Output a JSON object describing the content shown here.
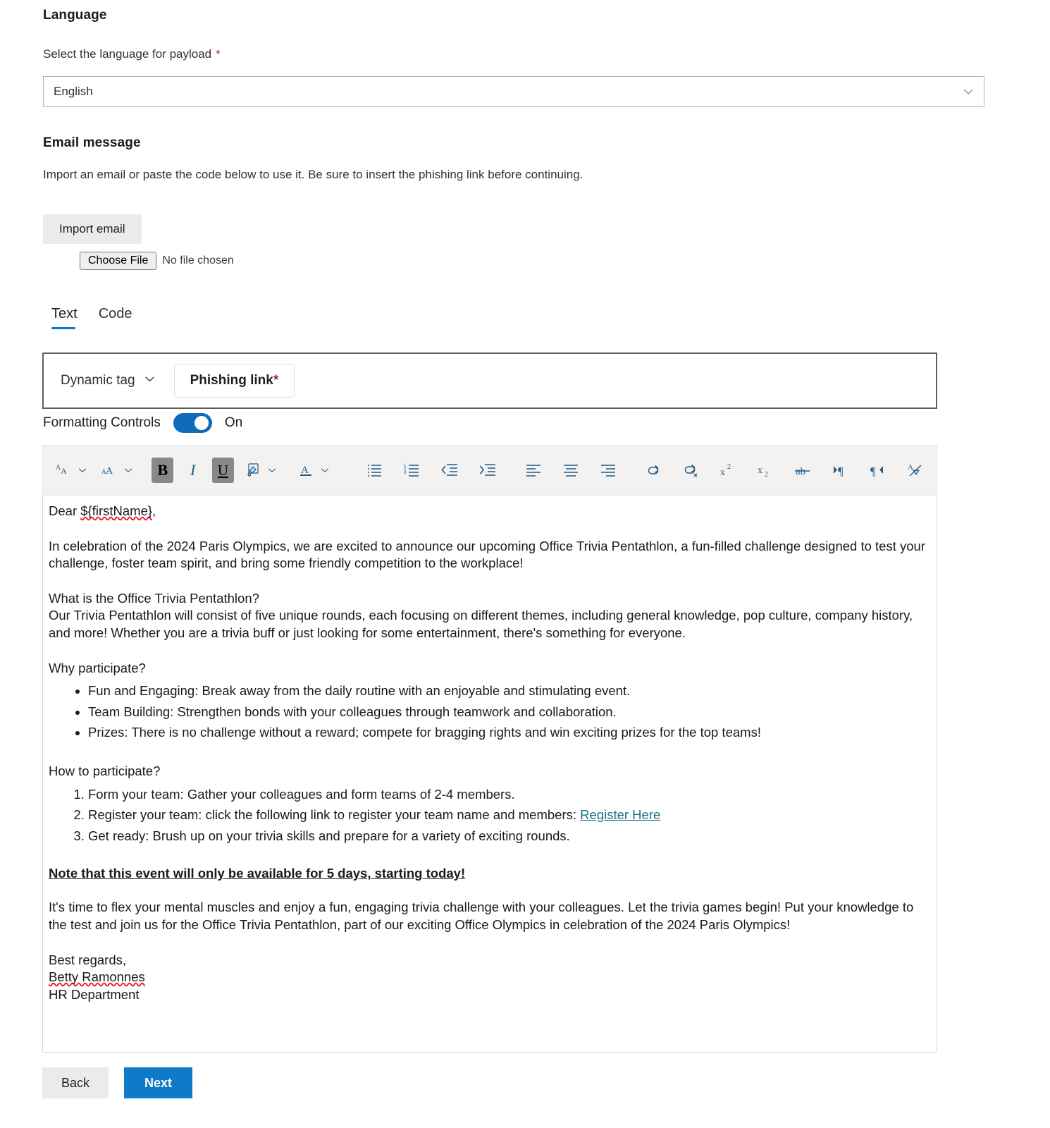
{
  "language_section": {
    "heading": "Language",
    "field_label": "Select the language for payload",
    "required_marker": "*",
    "selected_value": "English",
    "chevron_icon": "chevron-down-icon"
  },
  "email_section": {
    "heading": "Email message",
    "description": "Import an email or paste the code below to use it. Be sure to insert the phishing link before continuing.",
    "import_button": "Import email",
    "choose_file_button": "Choose File",
    "no_file_text": "No file chosen"
  },
  "tabs": [
    {
      "label": "Text",
      "active": true
    },
    {
      "label": "Code",
      "active": false
    }
  ],
  "tag_bar": {
    "dynamic_tag_label": "Dynamic tag",
    "dynamic_tag_chevron": "chevron-down-icon",
    "phishing_link_label": "Phishing link",
    "phishing_link_star": "*"
  },
  "formatting": {
    "label": "Formatting Controls",
    "toggle_state": "On",
    "toggle_on": true,
    "toggle_color": "#0f6cbd"
  },
  "toolbar": [
    {
      "name": "decrease-font-size-icon",
      "glyph": "Aᴀ",
      "type": "icon",
      "caret": true
    },
    {
      "name": "increase-font-size-icon",
      "glyph": "ᴀA",
      "type": "icon",
      "caret": true
    },
    {
      "name": "bold-icon",
      "glyph": "B",
      "type": "bold",
      "active": true
    },
    {
      "name": "italic-icon",
      "glyph": "I",
      "type": "ital"
    },
    {
      "name": "underline-icon",
      "glyph": "U",
      "type": "und",
      "active": true
    },
    {
      "name": "highlight-color-icon",
      "glyph": "svg-highlight",
      "type": "svg",
      "caret": true
    },
    {
      "name": "font-color-icon",
      "glyph": "svg-fontcolor",
      "type": "svg",
      "caret": true
    },
    {
      "name": "bulleted-list-icon",
      "glyph": "svg-bullets",
      "type": "svg"
    },
    {
      "name": "numbered-list-icon",
      "glyph": "svg-numbers",
      "type": "svg"
    },
    {
      "name": "decrease-indent-icon",
      "glyph": "svg-outdent",
      "type": "svg"
    },
    {
      "name": "increase-indent-icon",
      "glyph": "svg-indent",
      "type": "svg"
    },
    {
      "name": "align-left-icon",
      "glyph": "svg-alignleft",
      "type": "svg"
    },
    {
      "name": "align-center-icon",
      "glyph": "svg-aligncenter",
      "type": "svg"
    },
    {
      "name": "align-right-icon",
      "glyph": "svg-alignright",
      "type": "svg"
    },
    {
      "name": "insert-link-icon",
      "glyph": "svg-link",
      "type": "svg"
    },
    {
      "name": "remove-link-icon",
      "glyph": "svg-unlink",
      "type": "svg"
    },
    {
      "name": "superscript-icon",
      "glyph": "svg-sup",
      "type": "svg"
    },
    {
      "name": "subscript-icon",
      "glyph": "svg-sub",
      "type": "svg"
    },
    {
      "name": "strikethrough-icon",
      "glyph": "svg-strike",
      "type": "svg"
    },
    {
      "name": "ltr-direction-icon",
      "glyph": "svg-ltr",
      "type": "svg"
    },
    {
      "name": "rtl-direction-icon",
      "glyph": "svg-rtl",
      "type": "svg"
    },
    {
      "name": "clear-formatting-icon",
      "glyph": "svg-clear",
      "type": "svg"
    }
  ],
  "email_body": {
    "greeting": "Dear ${firstName},",
    "greeting_plain_prefix": "Dear ",
    "greeting_var": "${firstName}",
    "greeting_suffix": ",",
    "intro": "In celebration of the 2024 Paris Olympics, we are excited to announce our upcoming Office Trivia Pentathlon, a fun-filled challenge designed to test your challenge, foster team spirit, and bring some friendly competition to the workplace!",
    "what_heading": "What is the Office Trivia Pentathlon?",
    "what_body": "Our Trivia Pentathlon will consist of five unique rounds, each focusing on different themes, including general knowledge, pop culture, company history, and more! Whether you are a trivia buff or just looking for some entertainment, there's something for everyone.",
    "why_heading": "Why participate?",
    "why_bullets": [
      "Fun and Engaging: Break away from the daily routine with an enjoyable and stimulating event.",
      "Team Building: Strengthen bonds with your colleagues through teamwork and collaboration.",
      "Prizes: There is no challenge without a reward; compete for bragging rights and win exciting prizes for the top teams!"
    ],
    "how_heading": "How to participate?",
    "how_steps": [
      {
        "text": "Form your team: Gather your colleagues and form teams of 2-4 members.",
        "link": null
      },
      {
        "text": "Register your team: click the following link to register your team name and members: ",
        "link": "Register Here"
      },
      {
        "text": "Get ready: Brush up on your trivia skills and prepare for a variety of exciting rounds.",
        "link": null
      }
    ],
    "note": "Note that this event will only be available for 5 days, starting today!",
    "closing_paragraph": "It's time to flex your mental muscles and enjoy a fun, engaging trivia challenge with your colleagues. Let the trivia games begin! Put your knowledge to the test and join us for the Office Trivia Pentathlon, part of our exciting Office Olympics in celebration of the 2024 Paris Olympics!",
    "signoff": "Best regards,",
    "signer_name": "Betty Ramonnes",
    "signer_dept": "HR Department"
  },
  "footer": {
    "back_label": "Back",
    "next_label": "Next",
    "next_color": "#0f7ac7"
  }
}
